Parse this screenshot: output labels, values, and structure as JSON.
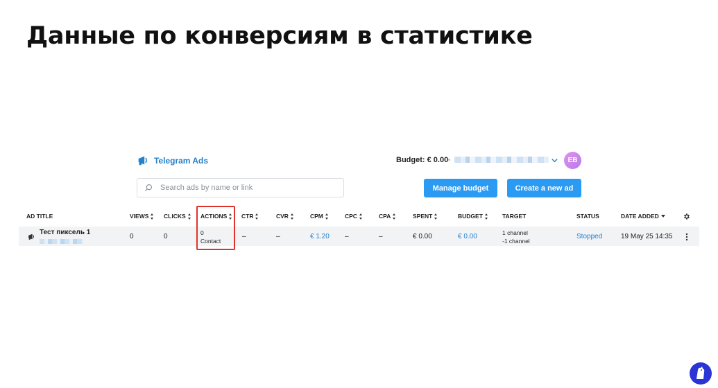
{
  "slide": {
    "title": "Данные по конверсиям в статистике"
  },
  "header": {
    "brand": "Telegram Ads",
    "budget": "Budget: € 0.00",
    "avatar_initials": "EB",
    "brand_color": "#2481cc",
    "avatar_color": "#c785ee"
  },
  "search": {
    "placeholder": "Search ads by name or link"
  },
  "buttons": {
    "manage_budget": "Manage budget",
    "create_ad": "Create a new ad",
    "color": "#2b9af3"
  },
  "table": {
    "columns": [
      "AD TITLE",
      "VIEWS",
      "CLICKS",
      "ACTIONS",
      "CTR",
      "CVR",
      "CPM",
      "CPC",
      "CPA",
      "SPENT",
      "BUDGET",
      "TARGET",
      "STATUS",
      "DATE ADDED"
    ],
    "rows": [
      {
        "ad_title": "Тест пиксель 1",
        "views": "0",
        "clicks": "0",
        "actions_count": "0",
        "actions_type": "Contact",
        "ctr": "–",
        "cvr": "–",
        "cpm": "€ 1.20",
        "cpc": "–",
        "cpa": "–",
        "spent": "€ 0.00",
        "budget": "€ 0.00",
        "target_line1": "1 channel",
        "target_line2": "-1 channel",
        "status": "Stopped",
        "date_added": "19 May 25 14:35"
      }
    ]
  },
  "highlight": {
    "column": "ACTIONS",
    "color": "#e0322b"
  }
}
